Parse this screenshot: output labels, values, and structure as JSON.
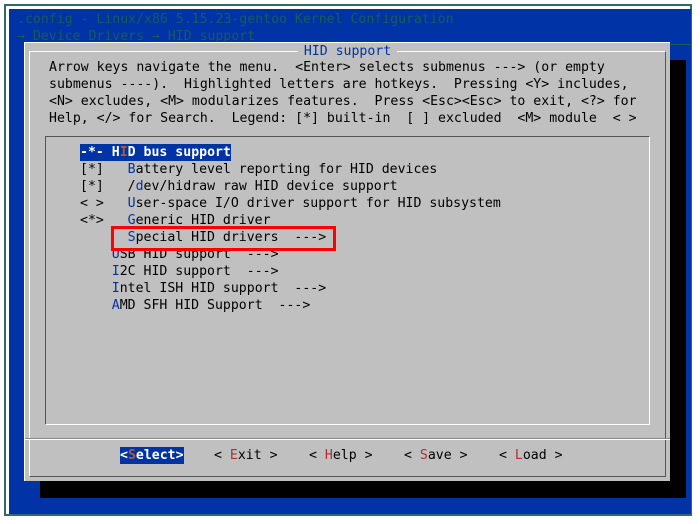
{
  "window": {
    "title": ".config - Linux/x86 5.15.23-gentoo Kernel Configuration",
    "breadcrumb": "→ Device Drivers → HID support"
  },
  "dialog": {
    "title": "HID support",
    "help_lines": [
      "Arrow keys navigate the menu.  <Enter> selects submenus ---> (or empty",
      "submenus ----).  Highlighted letters are hotkeys.  Pressing <Y> includes,",
      "<N> excludes, <M> modularizes features.  Press <Esc><Esc> to exit, <?> for",
      "Help, </> for Search.  Legend: [*] built-in  [ ] excluded  <M> module  < >"
    ]
  },
  "menu": {
    "items": [
      {
        "prefix": "-*- ",
        "hot": "H",
        "pre": "",
        "rest": "ID bus support",
        "selected": true,
        "hot_index_text": "H",
        "hot_letter": "I",
        "after": "D bus support"
      },
      {
        "prefix": "[*]   ",
        "hot": "B",
        "rest": "attery level reporting for HID devices"
      },
      {
        "prefix": "[*]   ",
        "pre": "/",
        "hot": "d",
        "rest": "ev/hidraw raw HID device support"
      },
      {
        "prefix": "< >   ",
        "hot": "U",
        "rest": "ser-space I/O driver support for HID subsystem"
      },
      {
        "prefix": "<*>   ",
        "hot": "G",
        "rest": "eneric HID driver"
      },
      {
        "prefix": "      ",
        "hot": "S",
        "rest": "pecial HID drivers  --->",
        "highlighted_box": true
      },
      {
        "prefix": "    ",
        "hot": "U",
        "rest": "SB HID support  --->"
      },
      {
        "prefix": "    ",
        "hot": "I",
        "rest": "2C HID support  --->"
      },
      {
        "prefix": "    ",
        "hot": "I",
        "rest": "ntel ISH HID support  --->"
      },
      {
        "prefix": "    ",
        "hot": "A",
        "rest": "MD SFH HID Support  --->"
      }
    ]
  },
  "buttons": [
    {
      "open": "<",
      "hot": "S",
      "rest": "elect",
      "close": ">",
      "active": true
    },
    {
      "open": "< ",
      "hot": "E",
      "rest": "xit",
      "close": " >"
    },
    {
      "open": "< ",
      "hot": "H",
      "rest": "elp",
      "close": " >"
    },
    {
      "open": "< ",
      "hot": "S",
      "rest": "ave",
      "close": " >"
    },
    {
      "open": "< ",
      "hot": "L",
      "rest": "oad",
      "close": " >"
    }
  ],
  "colors": {
    "background": "#0033a6",
    "dialog": "#c0c0c0",
    "hotkey": "#0033a6",
    "button_hotkey": "#b03030",
    "annotation_box": "#ff0000"
  }
}
